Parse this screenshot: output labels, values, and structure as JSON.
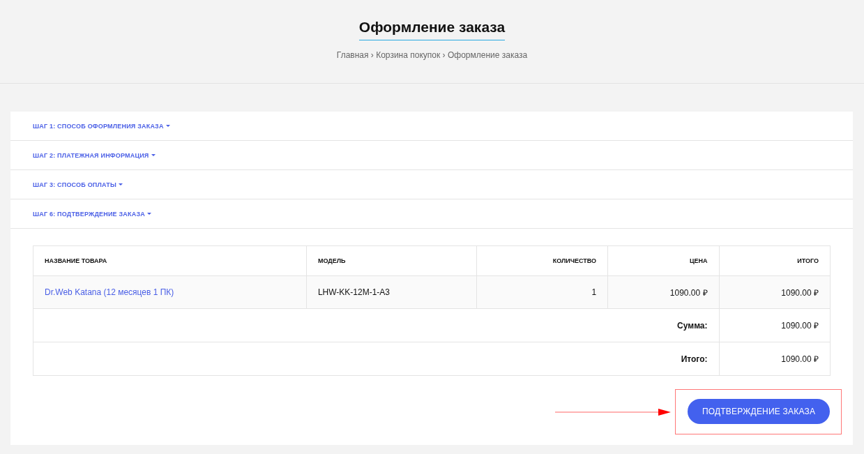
{
  "page_title": "Оформление заказа",
  "breadcrumbs": {
    "separator": "›",
    "items": [
      "Главная",
      "Корзина покупок",
      "Оформление заказа"
    ]
  },
  "steps": [
    {
      "label": "ШАГ 1: СПОСОБ ОФОРМЛЕНИЯ ЗАКАЗА"
    },
    {
      "label": "ШАГ 2: ПЛАТЕЖНАЯ ИНФОРМАЦИЯ"
    },
    {
      "label": "ШАГ 3: СПОСОБ ОПЛАТЫ"
    },
    {
      "label": "ШАГ 6: ПОДТВЕРЖДЕНИЕ ЗАКАЗА"
    }
  ],
  "table": {
    "columns": [
      "НАЗВАНИЕ ТОВАРА",
      "МОДЕЛЬ",
      "КОЛИЧЕСТВО",
      "ЦЕНА",
      "ИТОГО"
    ],
    "rows": [
      [
        "Dr.Web Katana (12 месяцев 1 ПК)",
        "LHW-KK-12M-1-A3",
        "1",
        "1090.00 ₽",
        "1090.00 ₽"
      ]
    ],
    "totals": [
      {
        "label": "Сумма:",
        "value": "1090.00 ₽"
      },
      {
        "label": "Итого:",
        "value": "1090.00 ₽"
      }
    ]
  },
  "confirm_button": "ПОДТВЕРЖДЕНИЕ ЗАКАЗА"
}
